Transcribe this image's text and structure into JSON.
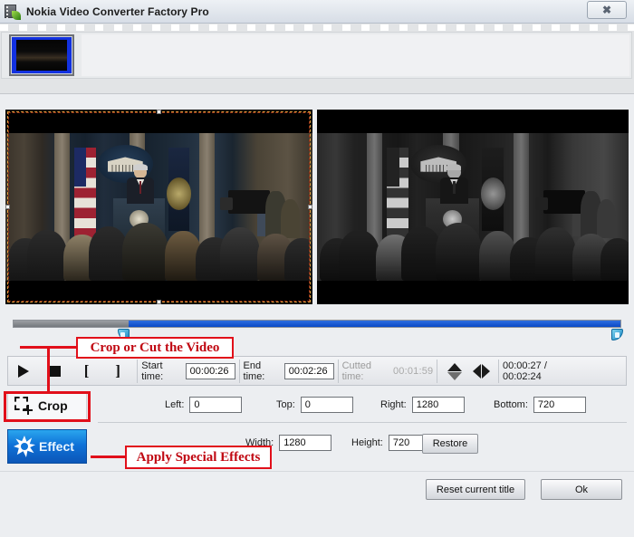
{
  "window": {
    "title": "Nokia Video Converter Factory Pro",
    "app_icon": "film-leaf-icon",
    "close_label": "✖"
  },
  "filmstrip": {
    "thumbnail_name": "video-thumbnail-1",
    "selected": true
  },
  "previews": {
    "left_name": "source-preview",
    "right_name": "effect-preview",
    "crop_overlay": "crop-selection-rectangle"
  },
  "seekbar": {
    "played_percent": 19,
    "start_marker": "start-trim-marker",
    "end_marker": "end-trim-marker"
  },
  "toolbar": {
    "play_icon": "play-icon",
    "stop_icon": "stop-icon",
    "mark_in_icon": "bracket-in-icon",
    "mark_in_glyph": "[",
    "mark_out_icon": "bracket-out-icon",
    "mark_out_glyph": "]",
    "start_time_label": "Start time:",
    "start_time_value": "00:00:26",
    "end_time_label": "End time:",
    "end_time_value": "00:02:26",
    "cutted_time_label": "Cutted time:",
    "cutted_time_value": "00:01:59",
    "flip_vertical_icon": "flip-vertical-icon",
    "flip_horizontal_icon": "flip-horizontal-icon",
    "position_readout": "00:00:27 / 00:02:24"
  },
  "crop": {
    "button_label": "Crop",
    "button_icon": "crop-marquee-icon",
    "left_label": "Left:",
    "left_value": "0",
    "top_label": "Top:",
    "top_value": "0",
    "right_label": "Right:",
    "right_value": "1280",
    "bottom_label": "Bottom:",
    "bottom_value": "720",
    "width_label": "Width:",
    "width_value": "1280",
    "height_label": "Height:",
    "height_value": "720",
    "restore_label": "Restore"
  },
  "effect": {
    "button_label": "Effect",
    "button_icon": "sparkle-icon"
  },
  "footer": {
    "reset_label": "Reset current title",
    "ok_label": "Ok"
  },
  "annotations": {
    "crop_or_cut": "Crop or Cut the Video",
    "apply_effects": "Apply Special Effects",
    "color": "#e10f1a"
  }
}
